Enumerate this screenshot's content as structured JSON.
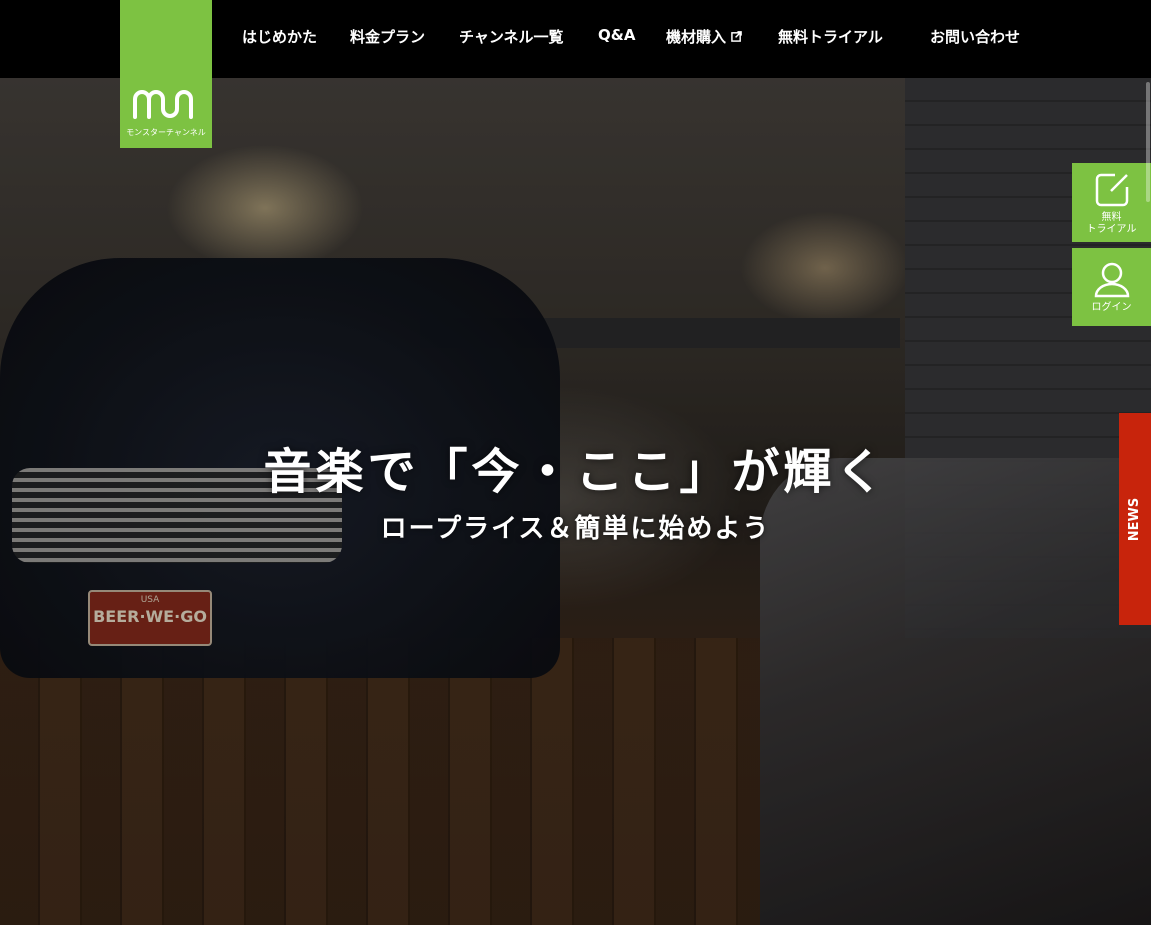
{
  "brand": {
    "name": "モンスターチャンネル",
    "color": "#7dc242"
  },
  "nav": {
    "items": [
      {
        "label": "はじめかた"
      },
      {
        "label": "料金プラン"
      },
      {
        "label": "チャンネル一覧"
      },
      {
        "label": "Q&A"
      },
      {
        "label": "機材購入",
        "external": true,
        "icon": "external-link-icon"
      },
      {
        "label": "無料トライアル"
      },
      {
        "label": "お問い合わせ"
      }
    ]
  },
  "hero": {
    "headline": "音楽で「今・ここ」が輝く",
    "subline": "ロープライス＆簡単に始めよう",
    "plate_text": "BEER·WE·GO",
    "plate_top": "USA"
  },
  "side": {
    "trial_label": "無料\nトライアル",
    "trial_icon": "edit-icon",
    "login_label": "ログイン",
    "login_icon": "user-icon",
    "news_label": "NEWS",
    "news_color": "#c8240c"
  }
}
